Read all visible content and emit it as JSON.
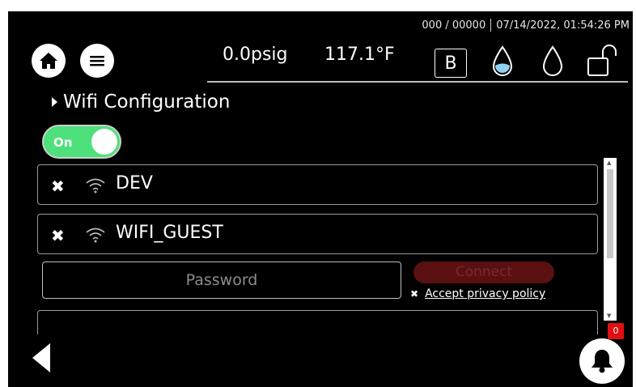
{
  "status_bar": {
    "counter": "000 / 00000",
    "datetime": "07/14/2022, 01:54:26 PM"
  },
  "header": {
    "pressure": "0.0psig",
    "temperature": "117.1°F",
    "mode_badge": "B",
    "icons": [
      "home-icon",
      "menu-icon",
      "water-drop-filled-icon",
      "water-drop-outline-icon",
      "unlocked-padlock-icon"
    ]
  },
  "section": {
    "title": "Wifi Configuration",
    "expand_icon": "caret-right-icon"
  },
  "wifi_toggle": {
    "label": "On",
    "state": "on",
    "color": "#4ee07a"
  },
  "networks": [
    {
      "name": "DEV",
      "remove_icon": "x-icon",
      "signal_icon": "wifi-icon"
    },
    {
      "name": "WIFI_GUEST",
      "remove_icon": "x-icon",
      "signal_icon": "wifi-icon"
    }
  ],
  "connect_form": {
    "password_placeholder": "Password",
    "password_value": "",
    "connect_label": "Connect",
    "privacy_label": "Accept privacy policy",
    "privacy_icon": "x-icon"
  },
  "footer": {
    "back_icon": "back-arrow-icon",
    "bell_icon": "bell-icon",
    "notification_count": "0"
  },
  "colors": {
    "background": "#000000",
    "accent_green": "#4ee07a",
    "connect_disabled": "#5a1010",
    "badge_red": "#e01010"
  }
}
